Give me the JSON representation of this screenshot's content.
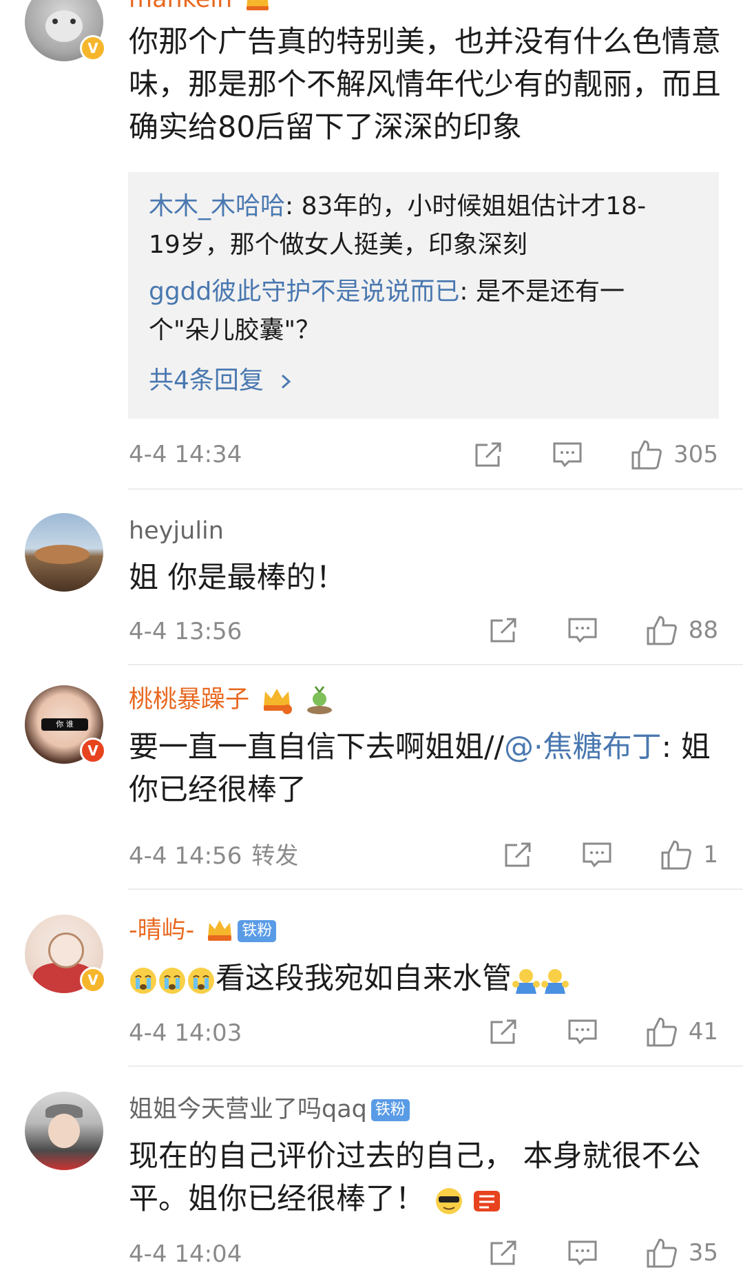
{
  "comments": [
    {
      "user": "mankein",
      "text": "你那个广告真的特别美，也并没有什么色情意味，那是那个不解风情年代少有的靓丽，而且确实给80后留下了深深的印象",
      "replies": [
        {
          "name": "木木_木哈哈",
          "text": ": 83年的，小时候姐姐估计才18-19岁，那个做女人挺美，印象深刻"
        },
        {
          "name": "ggdd彼此守护不是说说而已",
          "text": ": 是不是还有一个\"朵儿胶囊\"？"
        }
      ],
      "more_replies": "共4条回复",
      "time": "4-4 14:34",
      "likes": "305"
    },
    {
      "user": "heyjulin",
      "text": "姐 你是最棒的！",
      "time": "4-4 13:56",
      "likes": "88"
    },
    {
      "user": "桃桃暴躁子",
      "text_before": "要一直一直自信下去啊姐姐//",
      "mention": "@·焦糖布丁",
      "text_after": ": 姐 你已经很棒了",
      "time": "4-4 14:56",
      "repost": "转发",
      "likes": "1",
      "avatar_glasses_text": "你 谁"
    },
    {
      "user": "-晴屿-",
      "fan_tag": "铁粉",
      "text": "看这段我宛如自来水管",
      "time": "4-4 14:03",
      "likes": "41"
    },
    {
      "user": "姐姐今天营业了吗qaq",
      "fan_tag": "铁粉",
      "text": "现在的自己评价过去的自己， 本身就很不公平。姐你已经很棒了！",
      "time": "4-4 14:04",
      "likes": "35"
    }
  ],
  "colors": {
    "link": "#4a78b0",
    "username_vip": "#e8681f",
    "meta": "#8a8a8a",
    "reply_bg": "#f2f2f2",
    "verified_gold": "#f6b62b",
    "verified_red": "#e8431f",
    "fan_tag": "#5a9be6"
  },
  "icons": {
    "share": "share-icon",
    "comment": "comment-icon",
    "like": "thumbs-up-icon",
    "verified": "verified-badge-icon",
    "crown": "crown-badge-icon"
  }
}
